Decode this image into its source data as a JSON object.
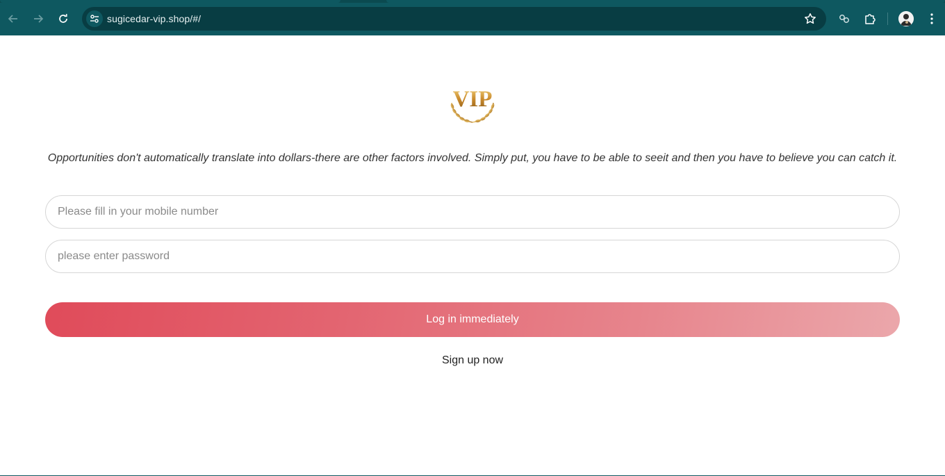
{
  "browser": {
    "url": "sugicedar-vip.shop/#/",
    "icons": [
      "back-arrow-icon",
      "forward-arrow-icon",
      "reload-icon",
      "site-settings-icon",
      "bookmark-star-icon",
      "link-extension-icon",
      "extensions-puzzle-icon",
      "profile-avatar",
      "kebab-menu-icon"
    ],
    "colors": {
      "toolbar": "#0e5860",
      "omnibox": "#083d43"
    }
  },
  "page": {
    "logo_text": "VIP",
    "quote": "Opportunities don't automatically translate into dollars-there are other factors involved. Simply put, you have to be able to seeit and then you have to believe you can catch it.",
    "mobile_placeholder": "Please fill in your mobile number",
    "password_placeholder": "please enter password",
    "login_label": "Log in immediately",
    "signup_label": "Sign up now",
    "colors": {
      "button_start": "#e04b5a",
      "button_end": "#eba7ab"
    }
  }
}
